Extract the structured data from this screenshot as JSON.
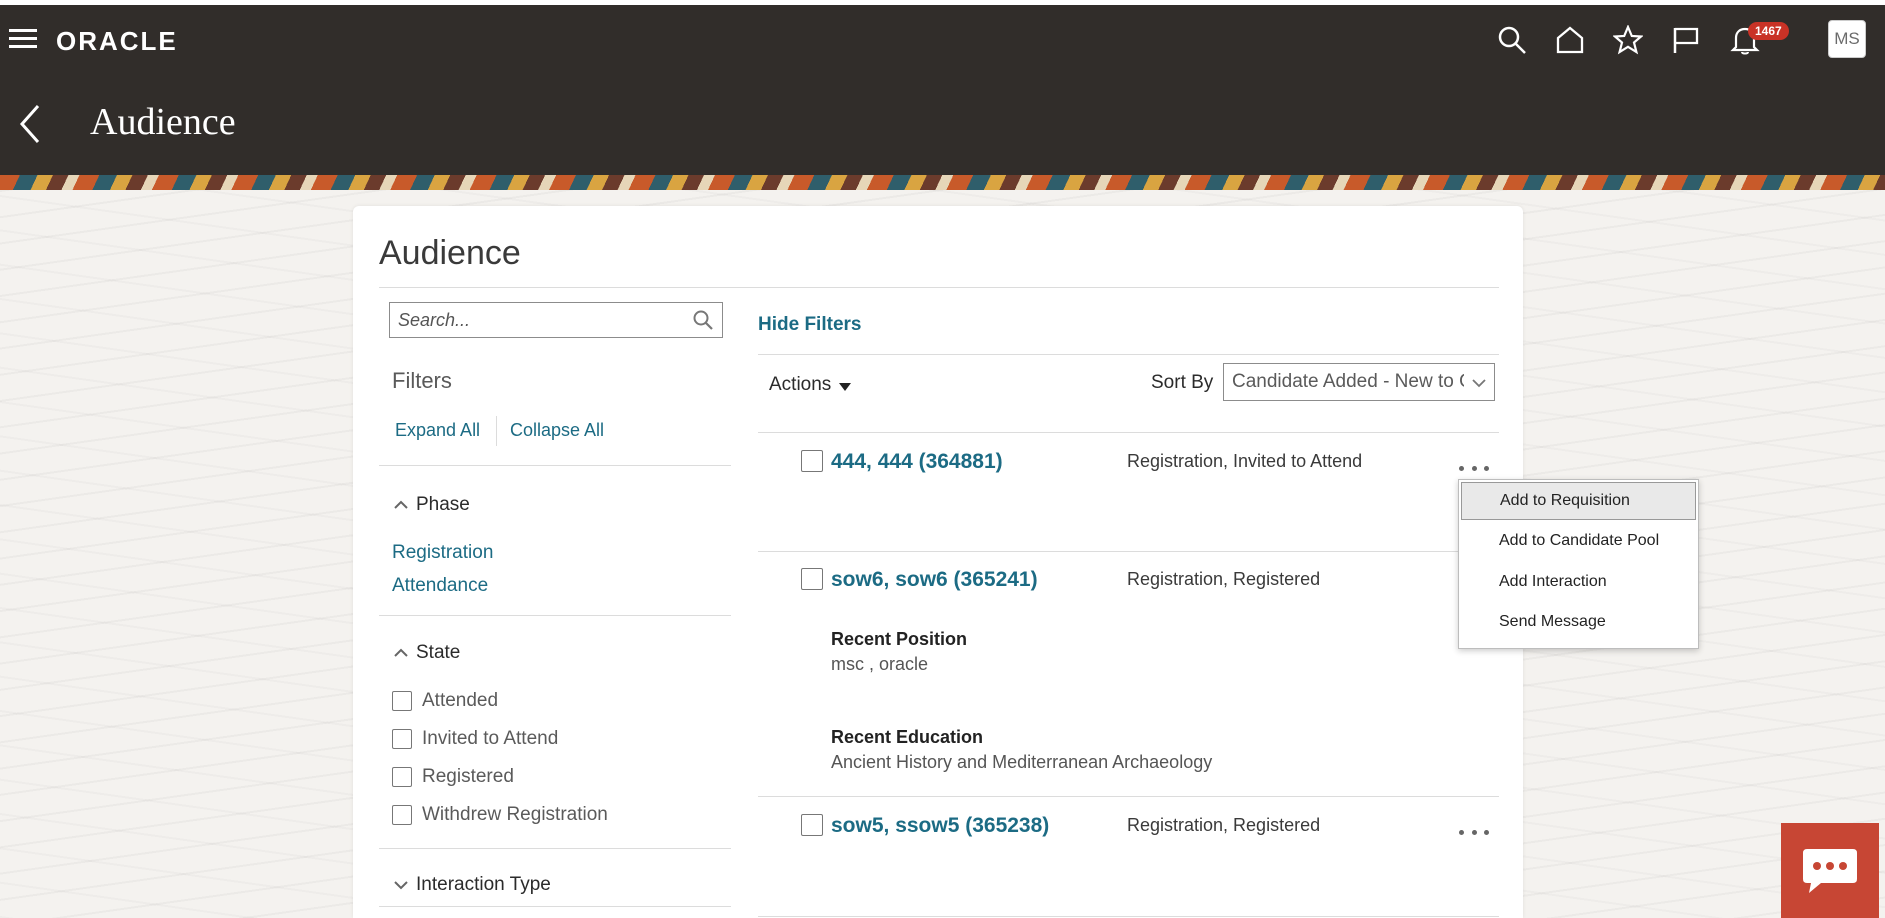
{
  "header": {
    "logo": "ORACLE",
    "page_title": "Audience",
    "notification_count": "1467",
    "avatar_initials": "MS"
  },
  "card": {
    "title": "Audience",
    "search_placeholder": "Search...",
    "hide_filters": "Hide Filters"
  },
  "filters": {
    "label": "Filters",
    "expand_all": "Expand All",
    "collapse_all": "Collapse All",
    "phase": {
      "title": "Phase",
      "items": [
        "Registration",
        "Attendance"
      ]
    },
    "state": {
      "title": "State",
      "items": [
        "Attended",
        "Invited to Attend",
        "Registered",
        "Withdrew Registration"
      ]
    },
    "interaction_type": {
      "title": "Interaction Type"
    }
  },
  "toolbar": {
    "actions": "Actions",
    "sort_by_label": "Sort By",
    "sort_by_value": "Candidate Added - New to Old"
  },
  "candidates": [
    {
      "name": "444, 444 (364881)",
      "status": "Registration, Invited to Attend"
    },
    {
      "name": "sow6, sow6 (365241)",
      "status": "Registration, Registered",
      "recent_position_label": "Recent Position",
      "recent_position": "msc , oracle",
      "recent_education_label": "Recent Education",
      "recent_education": "Ancient History and Mediterranean Archaeology"
    },
    {
      "name": "sow5, ssow5 (365238)",
      "status": "Registration, Registered"
    }
  ],
  "context_menu": {
    "items": [
      "Add to Requisition",
      "Add to Candidate Pool",
      "Add Interaction",
      "Send Message"
    ]
  },
  "colors": {
    "header_bg": "#312d2a",
    "link": "#1c6b84",
    "badge": "#c93226",
    "chat": "#c74634"
  }
}
